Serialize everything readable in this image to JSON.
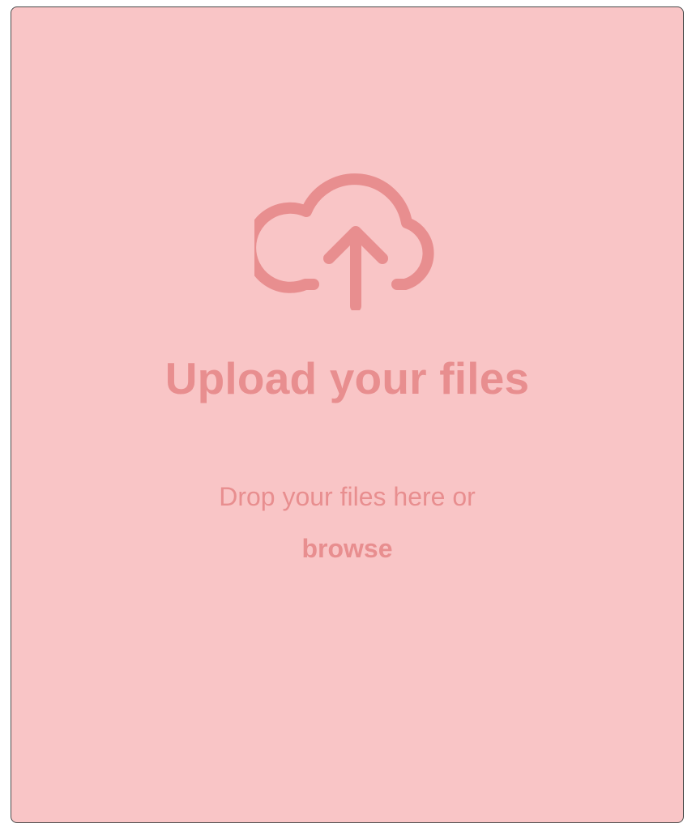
{
  "upload": {
    "icon": "cloud-upload-icon",
    "title": "Upload your files",
    "instruction": "Drop your files here or",
    "browse_label": "browse"
  },
  "colors": {
    "background": "#f9c5c6",
    "accent": "#e88e8f",
    "border": "#4a4a4a"
  }
}
